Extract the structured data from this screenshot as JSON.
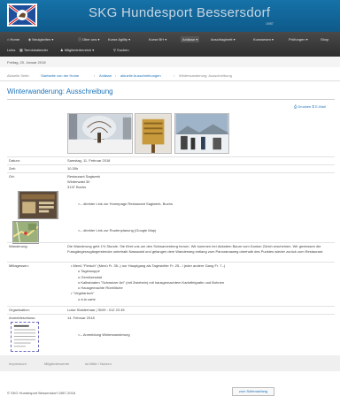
{
  "header": {
    "title": "SKG Hundesport Bessersdorf",
    "year": "1987"
  },
  "nav": {
    "row1": [
      "Home",
      "Neuigkeiten",
      "Über uns",
      "Kurse Agility",
      "Kurse BH",
      "Anlässe",
      "Anschlagbrett",
      "Kurswesen",
      "Prüfungen",
      "Shop"
    ],
    "row2": [
      "Links",
      "Terminkalender",
      "Mitgliederbereich",
      "Suchen"
    ]
  },
  "datebar": {
    "date": "Freitag, 20. Januar 2018"
  },
  "breadcrumb": {
    "prefix": "Aktuelle Seite:",
    "items": [
      "Startseite von der Home",
      "Anlässe",
      "aktuelle Ausschreibungen",
      "Winterwanderung: Ausschreibung"
    ]
  },
  "page": {
    "title": "Winterwanderung: Ausschreibung",
    "print_label": "Drucken",
    "email_label": "E-Mail"
  },
  "details": {
    "datum_label": "Datum:",
    "datum_value": "Samstag, 11. Februar 2018",
    "zeit_label": "Zeit:",
    "zeit_value": "10.30h",
    "ort_label": "Ort:",
    "ort_lines": [
      "Restaurant Sagiwerk",
      "Winterwald 30",
      "3137 Buchs"
    ],
    "restaurant_link": "<-- direkter Link zur Homepage Restaurant Sagiwerk, Buchs",
    "route_link": "<-- direkter Link zur Routenplanung (Google Map)",
    "wanderung_label": "Wanderung:",
    "wanderung_text": "Die Wanderung geht 1½ Stunde. Sie führt uns um den Schwarzenberg herum. Wir kommen bei dickstem Baum vom Kanton Zürich erscheinen. Wir geniessen die Fussgängerzugängerstrecke unterhalb Nasswald und gelangen dem Wanderweg entlang zum Panoramaweg oberhalb des Punktes wieder zurück zum Restaurant.",
    "mittag_label": "Mittagessen:",
    "menu_items": [
      "• Menü \"Fleisch\" (Menü Fr. 35.-) nur Hauptgang als Tagesteller Fr. 25.- / jeder andere Gang Fr. 7.-)",
      "o Tagessuppe",
      "o Gemüsesalat",
      "o Kalbsbraten \"Schweizer Art\" (mit Zwiebeln) mit hausgemachtem Kartoffelgratin und Bohnen",
      "o Hausgemachte Rüeblitorte",
      "• \"Vegetarisch\"",
      "o à la carte"
    ],
    "organisation_label": "Organisation:",
    "organisation_value": "Luise Stalderhaar  |  SMH : 012 23 45",
    "anmelde_label": "Anmeldeschluss:",
    "anmelde_value": "14. Februar 2018",
    "anmeldung_link": "<-- Anmeldung Winterwanderung"
  },
  "footer": {
    "links": [
      "Impressum",
      "Mitgliederwerbe",
      "ist Mitte / Nutzen"
    ],
    "copyright": "© SKG Hundesport Bessersdorf 1987-2018",
    "top_label": "zum Seitenanfang"
  },
  "colors": {
    "header_blue": "#0e5a8a",
    "link_blue": "#1d73b8",
    "nav_dark": "#3a3a3a"
  }
}
